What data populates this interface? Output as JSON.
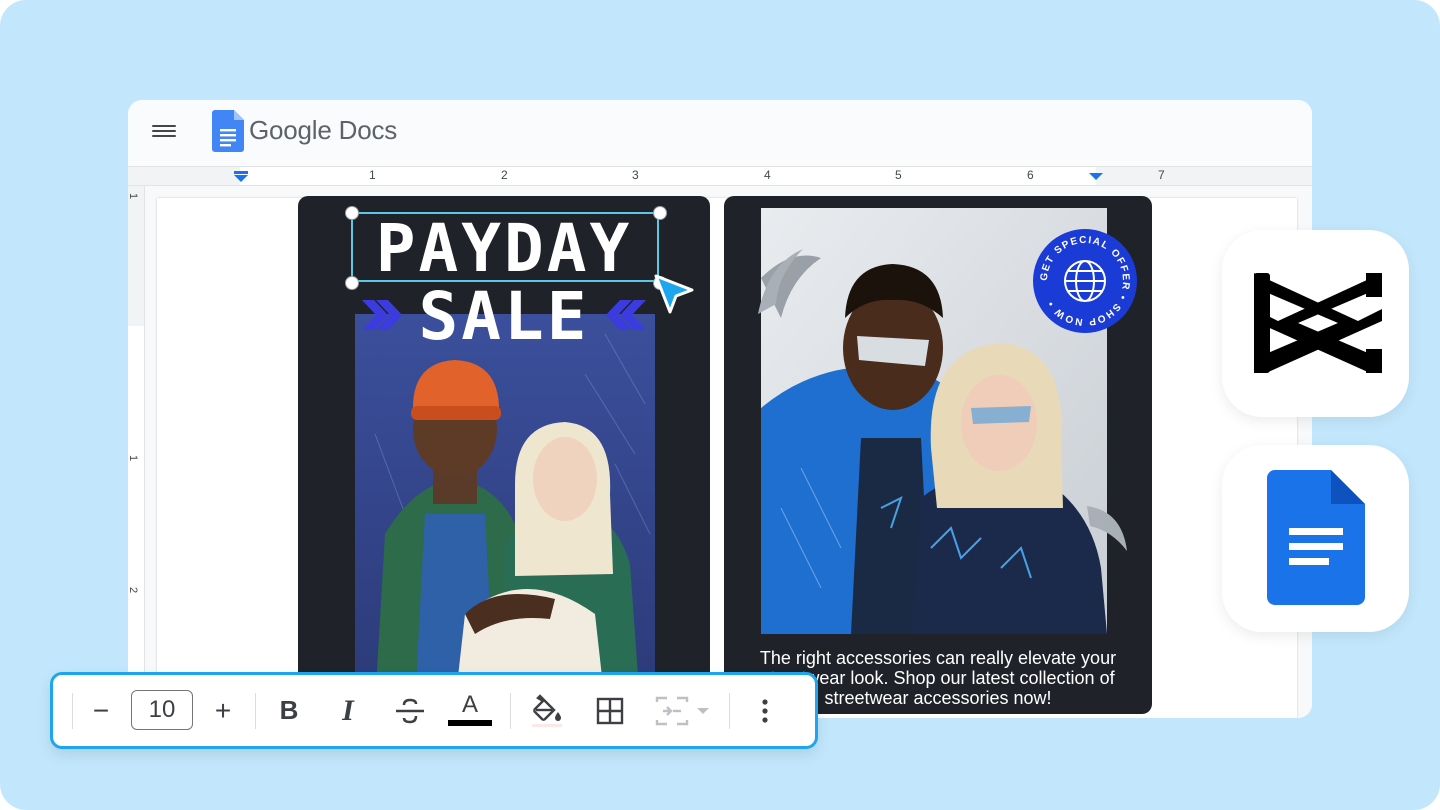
{
  "app": {
    "name": "Google Docs"
  },
  "ruler": {
    "numbers": [
      "1",
      "2",
      "3",
      "4",
      "5",
      "6",
      "7"
    ],
    "vertical_numbers": [
      "1",
      "1",
      "2"
    ]
  },
  "poster_left": {
    "headline_line1": "PAYDAY",
    "headline_line2": "SALE"
  },
  "poster_right": {
    "caption": "The right accessories can really elevate your streetwear look. Shop our latest collection of streetwear accessories now!",
    "badge_text": "GET SPECIAL OFFER • SHOP NOW •"
  },
  "toolbar": {
    "decrease_label": "−",
    "font_size_value": "10",
    "increase_label": "+",
    "bold_label": "B",
    "italic_label": "I",
    "strike_label": "S",
    "text_color_label": "A",
    "text_color": "#000000"
  },
  "colors": {
    "background": "#c2e7fc",
    "toolbar_border": "#1ea5f0",
    "selection": "#5bc8e6",
    "docs_blue": "#4285f4",
    "badge_blue": "#1a3bd6",
    "poster_bg": "#1f2329"
  },
  "icons": [
    "menu-icon",
    "google-docs-icon",
    "cursor-arrow-icon",
    "capcut-icon",
    "fill-color-icon",
    "table-icon",
    "link-icon",
    "more-vert-icon",
    "globe-icon"
  ]
}
